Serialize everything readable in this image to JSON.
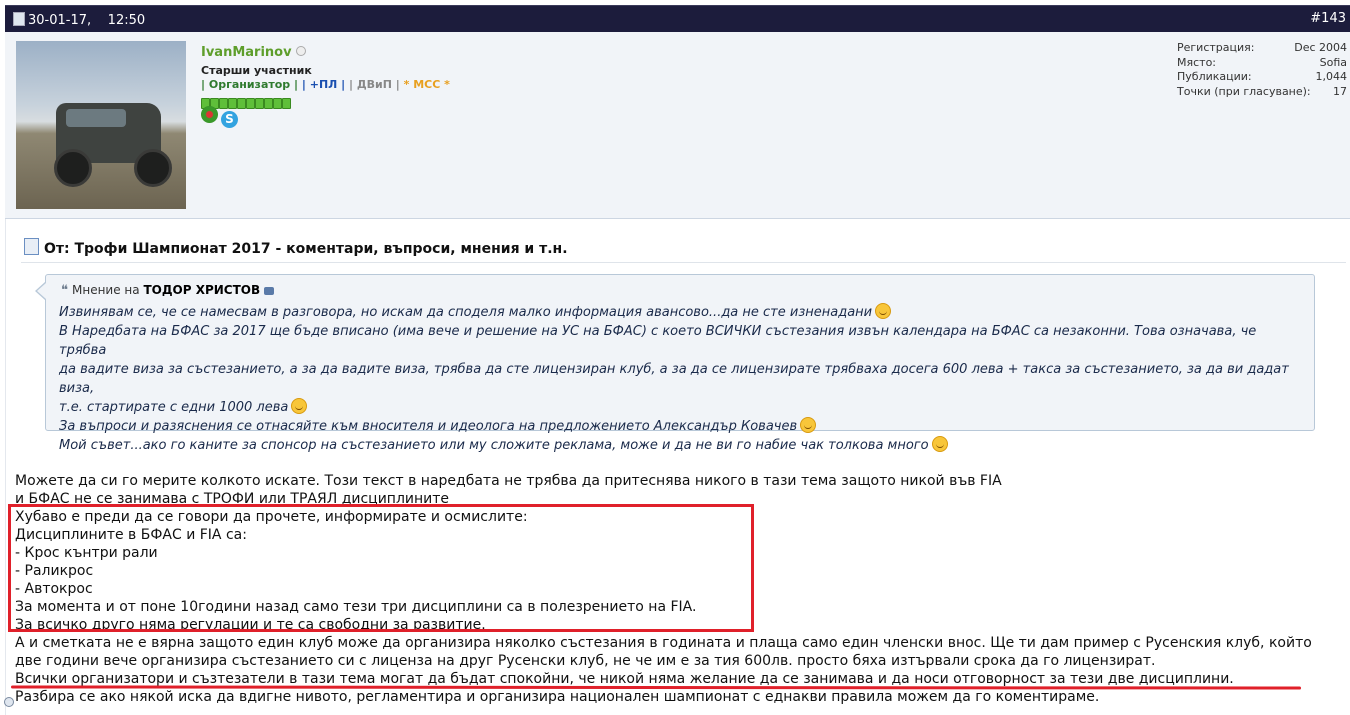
{
  "header": {
    "date": "30-01-17,",
    "time": "12:50",
    "post_number": "#143"
  },
  "user": {
    "name": "IvanMarinov",
    "title": "Старши участник",
    "groups": {
      "g1": "| Организатор |",
      "g2": "| +ПЛ |",
      "g3": "| ДВиП |",
      "g4": "* МСС *"
    },
    "reputation_segments": 10,
    "stats": [
      {
        "label": "Регистрация:",
        "value": "Dec 2004"
      },
      {
        "label": "Място:",
        "value": "Sofia"
      },
      {
        "label": "Публикации:",
        "value": "1,044"
      },
      {
        "label": "Точки (при гласуване):",
        "value": "17"
      }
    ]
  },
  "post": {
    "title": "От: Трофи Шампионат 2017 - коментари, въпроси, мнения и т.н.",
    "quote": {
      "prefix": "Мнение на",
      "author": "ТОДОР ХРИСТОВ",
      "lines": [
        "Извинявам се, че се намесвам в разговора, но искам да споделя малко информация авансово...да не сте изненадани",
        "В Наредбата на БФАС за 2017 ще бъде вписано (има вече и решение на УС на БФАС) с което ВСИЧКИ състезания извън календара на БФАС са незаконни. Това означава, че трябва",
        "да вадите виза за състезанието, а за да вадите виза, трябва да сте лицензиран клуб, а за да се лицензирате трябваха досега 600 лева + такса за състезанието, за да ви дадат виза,",
        "т.е. стартирате с едни 1000 лева",
        "За въпроси и разяснения се отнасяйте към вносителя и идеолога на предложението Александър Ковачев",
        "Мой съвет...ако го каните за спонсор на състезанието или му сложите реклама, може и да не ви го набие чак толкова много"
      ]
    },
    "body_lines": [
      "Можете да си го мерите колкото искате. Този текст в наредбата не трябва да притеснява никого в тази тема защото никой във FIA",
      "и БФАС не се занимава с ТРОФИ или ТРАЯЛ дисциплините",
      "Хубаво е преди да се говори да прочете, информирате и осмислите:",
      "Дисциплините в БФАС и FIA са:",
      "- Крос кънтри рали",
      "- Раликрос",
      "- Автокрос",
      "За момента и от поне 10години назад само тези три дисциплини са в полезрението на FIA.",
      "За всичко друго няма регулации и те са свободни за развитие.",
      "А и сметката не е вярна защото един клуб може да организира няколко състезания в годината и плаща само един членски внос. Ще ти дам пример с Русенския клуб, който",
      "две години вече организира състезанието си с лиценза на друг Русенски клуб, не че им е за тия 600лв. просто бяха изтървали срока да го лицензират.",
      "Всички организатори и съзтезатели в тази тема могат да бъдат спокойни, че никой няма желание да се занимава и да носи отговорност за тези две дисциплини.",
      "Разбира се ако някой иска да вдигне нивото, регламентира и организира национален шампионат с еднакви правила можем да го коментираме."
    ]
  },
  "colors": {
    "header_bg": "#1c1c3c",
    "username": "#5e9e2b",
    "highlight": "#e0202a"
  }
}
